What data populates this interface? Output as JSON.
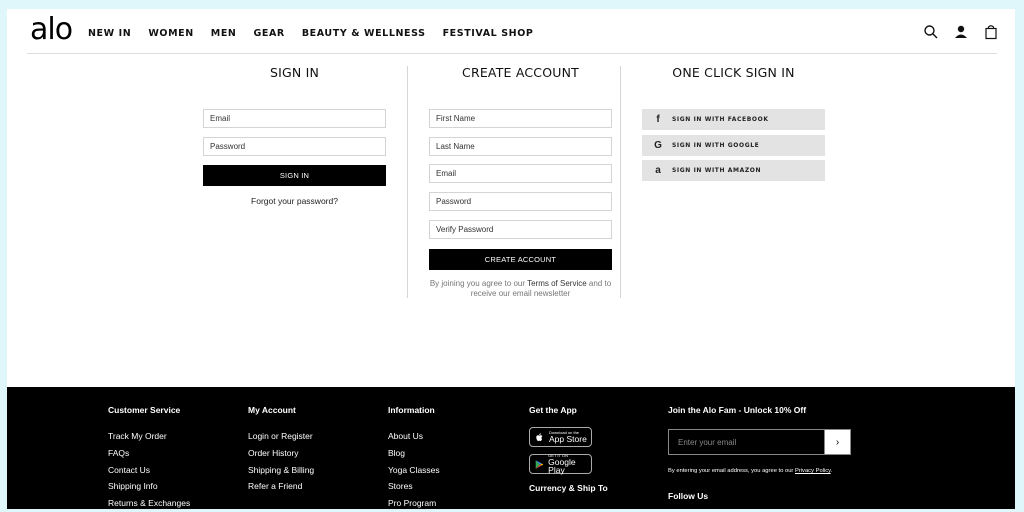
{
  "header": {
    "logo": "alo",
    "nav": [
      "NEW IN",
      "WOMEN",
      "MEN",
      "GEAR",
      "BEAUTY & WELLNESS",
      "FESTIVAL SHOP"
    ]
  },
  "signin": {
    "title": "SIGN IN",
    "email_placeholder": "Email",
    "password_placeholder": "Password",
    "button": "SIGN IN",
    "forgot": "Forgot your password?"
  },
  "create": {
    "title": "CREATE ACCOUNT",
    "first_name_placeholder": "First Name",
    "last_name_placeholder": "Last Name",
    "email_placeholder": "Email",
    "password_placeholder": "Password",
    "verify_placeholder": "Verify Password",
    "button": "CREATE ACCOUNT",
    "terms_pre": "By joining you agree to our ",
    "terms_link": "Terms of Service",
    "terms_post": " and to receive our email newsletter"
  },
  "oneclick": {
    "title": "ONE CLICK SIGN IN",
    "buttons": [
      {
        "icon": "facebook-icon",
        "glyph": "f",
        "label": "SIGN IN WITH FACEBOOK"
      },
      {
        "icon": "google-icon",
        "glyph": "G",
        "label": "SIGN IN WITH GOOGLE"
      },
      {
        "icon": "amazon-icon",
        "glyph": "a",
        "label": "SIGN IN WITH AMAZON"
      }
    ]
  },
  "footer": {
    "customer_service": {
      "title": "Customer Service",
      "links": [
        "Track My Order",
        "FAQs",
        "Contact Us",
        "Shipping Info",
        "Returns & Exchanges"
      ]
    },
    "my_account": {
      "title": "My Account",
      "links": [
        "Login or Register",
        "Order History",
        "Shipping & Billing",
        "Refer a Friend"
      ]
    },
    "information": {
      "title": "Information",
      "links": [
        "About Us",
        "Blog",
        "Yoga Classes",
        "Stores",
        "Pro Program"
      ]
    },
    "app": {
      "title": "Get the App",
      "appstore_small": "Download on the",
      "appstore_big": "App Store",
      "googleplay_small": "GET IT ON",
      "googleplay_big": "Google Play",
      "currency": "Currency & Ship To"
    },
    "join": {
      "title": "Join the Alo Fam - Unlock 10% Off",
      "placeholder": "Enter your email",
      "go": "›",
      "legal_pre": "By entering your email address, you agree to our ",
      "legal_link": "Privacy Policy",
      "legal_post": ".",
      "follow": "Follow Us"
    }
  }
}
